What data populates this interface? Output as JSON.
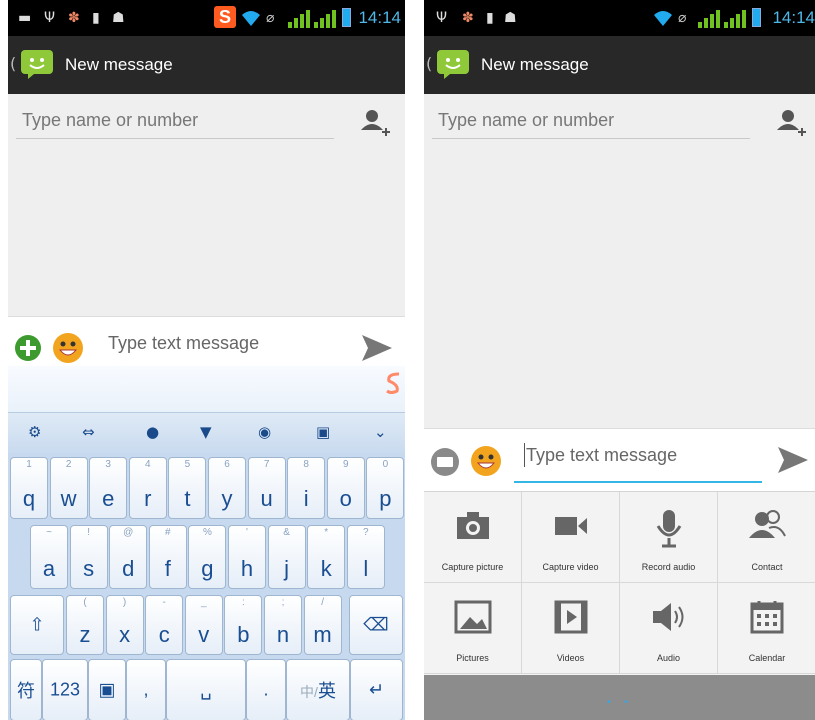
{
  "status": {
    "time": "14:14",
    "sogou_badge": "S"
  },
  "header": {
    "title": "New message",
    "back_glyph": "("
  },
  "recipient": {
    "placeholder": "Type name or number"
  },
  "composer": {
    "placeholder": "Type text message"
  },
  "keyboard": {
    "row1": [
      {
        "main": "q",
        "hint": "1"
      },
      {
        "main": "w",
        "hint": "2"
      },
      {
        "main": "e",
        "hint": "3"
      },
      {
        "main": "r",
        "hint": "4"
      },
      {
        "main": "t",
        "hint": "5"
      },
      {
        "main": "y",
        "hint": "6"
      },
      {
        "main": "u",
        "hint": "7"
      },
      {
        "main": "i",
        "hint": "8"
      },
      {
        "main": "o",
        "hint": "9"
      },
      {
        "main": "p",
        "hint": "0"
      }
    ],
    "row2": [
      {
        "main": "a",
        "hint": "~"
      },
      {
        "main": "s",
        "hint": "!"
      },
      {
        "main": "d",
        "hint": "@"
      },
      {
        "main": "f",
        "hint": "#"
      },
      {
        "main": "g",
        "hint": "%"
      },
      {
        "main": "h",
        "hint": "'"
      },
      {
        "main": "j",
        "hint": "&"
      },
      {
        "main": "k",
        "hint": "*"
      },
      {
        "main": "l",
        "hint": "?"
      }
    ],
    "row3": [
      {
        "main": "z",
        "hint": "("
      },
      {
        "main": "x",
        "hint": ")"
      },
      {
        "main": "c",
        "hint": "-"
      },
      {
        "main": "v",
        "hint": "_"
      },
      {
        "main": "b",
        "hint": ":"
      },
      {
        "main": "n",
        "hint": ";"
      },
      {
        "main": "m",
        "hint": "/"
      }
    ],
    "shift_label": "⇧",
    "delete_label": "⌫",
    "symbols_label": "符",
    "numbers_label": "123",
    "comma_label": ",",
    "space_label": "␣",
    "period_label": ".",
    "lang_label_cn": "中/",
    "lang_label_en": "英",
    "enter_label": "↵",
    "toolbar_collapse": "⌄"
  },
  "attach": {
    "items": [
      {
        "label": "Capture picture",
        "icon": "camera-icon"
      },
      {
        "label": "Capture video",
        "icon": "video-camera-icon"
      },
      {
        "label": "Record audio",
        "icon": "microphone-icon"
      },
      {
        "label": "Contact",
        "icon": "contact-icon"
      },
      {
        "label": "Pictures",
        "icon": "picture-icon"
      },
      {
        "label": "Videos",
        "icon": "video-file-icon"
      },
      {
        "label": "Audio",
        "icon": "speaker-icon"
      },
      {
        "label": "Calendar",
        "icon": "calendar-icon"
      }
    ]
  },
  "colors": {
    "accent": "#33b5e5",
    "keyboard_text": "#1a4e92",
    "signal_green": "#6fc21f"
  }
}
